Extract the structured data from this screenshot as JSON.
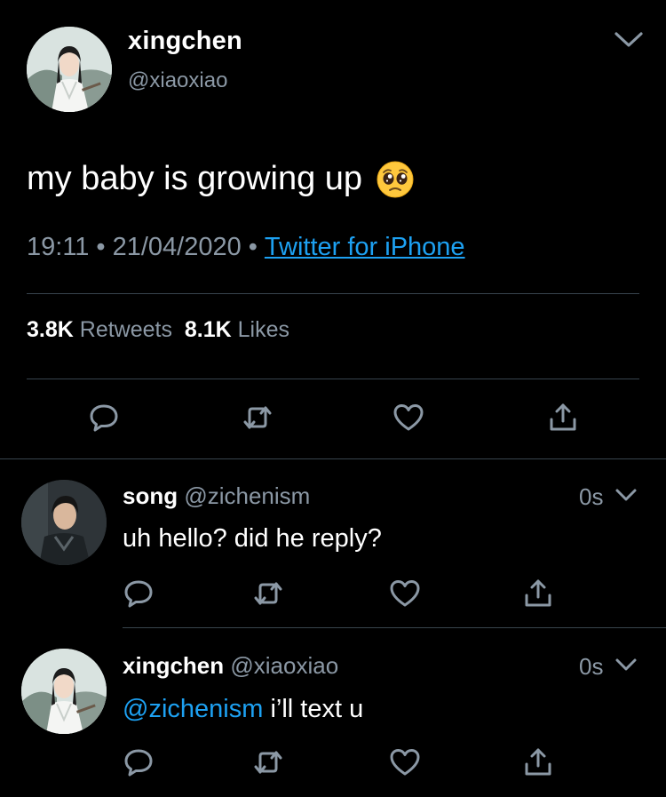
{
  "colors": {
    "background": "#000000",
    "secondary_text": "#8b98a5",
    "accent": "#1da1f2",
    "divider": "#38444d"
  },
  "main_tweet": {
    "name": "xingchen",
    "handle": "@xiaoxiao",
    "text": "my baby is growing up",
    "emoji": "pleading-face-emoji",
    "time": "19:11",
    "date": "21/04/2020",
    "source": "Twitter for iPhone",
    "retweets_count": "3.8K",
    "retweets_label": "Retweets",
    "likes_count": "8.1K",
    "likes_label": "Likes"
  },
  "replies": [
    {
      "name": "song",
      "handle": "@zichenism",
      "time": "0s",
      "text": "uh hello? did he reply?"
    },
    {
      "name": "xingchen",
      "handle": "@xiaoxiao",
      "time": "0s",
      "mention": "@zichenism",
      "text": "i’ll text u"
    }
  ],
  "separator": "•",
  "icons": [
    "chevron-down-icon",
    "reply-icon",
    "retweet-icon",
    "like-icon",
    "share-icon"
  ]
}
